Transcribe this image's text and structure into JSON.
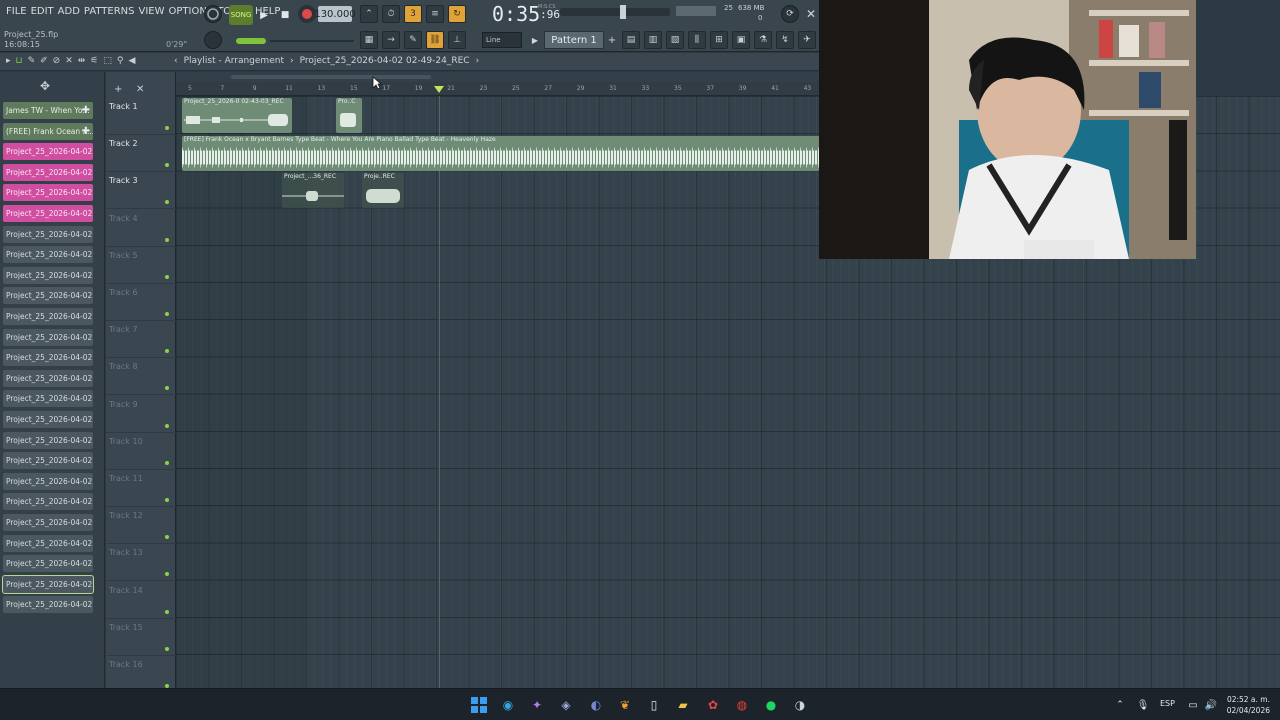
{
  "menu": [
    "FILE",
    "EDIT",
    "ADD",
    "PATTERNS",
    "VIEW",
    "OPTIONS",
    "TOOLS",
    "HELP"
  ],
  "project": {
    "file": "Project_25.flp",
    "time": "16:08:15",
    "pct": "0'29\""
  },
  "transport": {
    "mode": "SONG",
    "tempo": "130.000",
    "clock": "0:35",
    "clock_frac": ":96",
    "clock_unit": "M:S:CS"
  },
  "memory": {
    "value": "638 MB",
    "cpu": "25",
    "voices": "0"
  },
  "snap": "Line",
  "pattern": "Pattern 1",
  "playlist": {
    "breadcrumb_1": "Playlist - Arrangement",
    "breadcrumb_2": "Project_25_2026-04-02 02-49-24_REC"
  },
  "picker": [
    {
      "label": "James TW - When Yo...",
      "style": "green",
      "plus": true
    },
    {
      "label": "(FREE) Frank Ocean x...",
      "style": "green",
      "plus": true
    },
    {
      "label": "Project_25_2026-04-02...",
      "style": "pink"
    },
    {
      "label": "Project_25_2026-04-02...",
      "style": "pink"
    },
    {
      "label": "Project_25_2026-04-02...",
      "style": "pink"
    },
    {
      "label": "Project_25_2026-04-02...",
      "style": "pink"
    },
    {
      "label": "Project_25_2026-04-02...",
      "style": "gray"
    },
    {
      "label": "Project_25_2026-04-02...",
      "style": "gray"
    },
    {
      "label": "Project_25_2026-04-02...",
      "style": "gray"
    },
    {
      "label": "Project_25_2026-04-02...",
      "style": "gray"
    },
    {
      "label": "Project_25_2026-04-02...",
      "style": "gray"
    },
    {
      "label": "Project_25_2026-04-02...",
      "style": "gray"
    },
    {
      "label": "Project_25_2026-04-02...",
      "style": "gray"
    },
    {
      "label": "Project_25_2026-04-02...",
      "style": "gray"
    },
    {
      "label": "Project_25_2026-04-02...",
      "style": "gray"
    },
    {
      "label": "Project_25_2026-04-02...",
      "style": "gray"
    },
    {
      "label": "Project_25_2026-04-02...",
      "style": "gray"
    },
    {
      "label": "Project_25_2026-04-02...",
      "style": "gray"
    },
    {
      "label": "Project_25_2026-04-02...",
      "style": "gray"
    },
    {
      "label": "Project_25_2026-04-02...",
      "style": "gray"
    },
    {
      "label": "Project_25_2026-04-02...",
      "style": "gray"
    },
    {
      "label": "Project_25_2026-04-02...",
      "style": "gray"
    },
    {
      "label": "Project_25_2026-04-02...",
      "style": "gray"
    },
    {
      "label": "Project_25_2026-04-02...",
      "style": "gray",
      "selected": true
    },
    {
      "label": "Project_25_2026-04-02...",
      "style": "gray"
    }
  ],
  "tracks": [
    {
      "name": "Track 1",
      "active": true
    },
    {
      "name": "Track 2",
      "active": true
    },
    {
      "name": "Track 3",
      "active": true
    },
    {
      "name": "Track 4",
      "active": false
    },
    {
      "name": "Track 5",
      "active": false
    },
    {
      "name": "Track 6",
      "active": false
    },
    {
      "name": "Track 7",
      "active": false
    },
    {
      "name": "Track 8",
      "active": false
    },
    {
      "name": "Track 9",
      "active": false
    },
    {
      "name": "Track 10",
      "active": false
    },
    {
      "name": "Track 11",
      "active": false
    },
    {
      "name": "Track 12",
      "active": false
    },
    {
      "name": "Track 13",
      "active": false
    },
    {
      "name": "Track 14",
      "active": false
    },
    {
      "name": "Track 15",
      "active": false
    },
    {
      "name": "Track 16",
      "active": false
    }
  ],
  "ruler": [
    "5",
    "7",
    "9",
    "11",
    "13",
    "15",
    "17",
    "19",
    "21",
    "23",
    "25",
    "27",
    "29",
    "31",
    "33",
    "35",
    "37",
    "39",
    "41",
    "43"
  ],
  "clips": {
    "c1_title": "Project_25_2026-0 02-43-03_REC",
    "c2_title": "Pro..C",
    "c3_title": "[FREE] Frank Ocean x Bryant Barnes Type Beat - Where You Are  Piano Ballad Type Beat - Heavenly Haze",
    "c4_title": "Project_...36_REC",
    "c5_title": "Proje..REC"
  },
  "taskbar": {
    "lang": "ESP",
    "time": "02:52 a. m.",
    "date": "02/04/2026"
  },
  "colors": {
    "accent_green": "#8fd04a",
    "clip_green": "#6f8c77",
    "pink": "#d04ea0",
    "record_red": "#e04848",
    "playhead": "#c5e35a"
  }
}
